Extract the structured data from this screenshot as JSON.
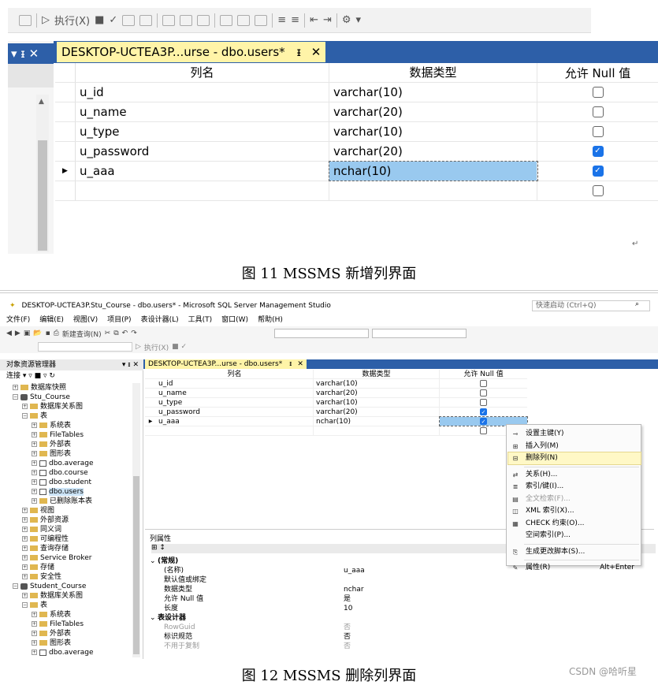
{
  "fig1": {
    "toolbar": {
      "execute_label": "执行(X)"
    },
    "tab": {
      "title": "DESKTOP-UCTEA3P...urse - dbo.users*",
      "pin": "ᵻ",
      "close": "✕"
    },
    "panel_controls": "▾ ᵻ ✕",
    "columns": {
      "name": "列名",
      "type": "数据类型",
      "null": "允许 Null 值"
    },
    "rows": [
      {
        "name": "u_id",
        "type": "varchar(10)",
        "null": false
      },
      {
        "name": "u_name",
        "type": "varchar(20)",
        "null": false
      },
      {
        "name": "u_type",
        "type": "varchar(10)",
        "null": false
      },
      {
        "name": "u_password",
        "type": "varchar(20)",
        "null": true
      },
      {
        "name": "u_aaa",
        "type": "nchar(10)",
        "null": true
      }
    ]
  },
  "caption1": "图 11 MSSMS 新增列界面",
  "fig2": {
    "title": "DESKTOP-UCTEA3P.Stu_Course - dbo.users* - Microsoft SQL Server Management Studio",
    "quick_launch": "快速启动 (Ctrl+Q)",
    "menu": [
      "文件(F)",
      "编辑(E)",
      "视图(V)",
      "项目(P)",
      "表设计器(L)",
      "工具(T)",
      "窗口(W)",
      "帮助(H)"
    ],
    "new_query": "新建查询(N)",
    "execute": "执行(X)",
    "object_explorer": {
      "title": "对象资源管理器",
      "connect": "连接 ▾",
      "tree": [
        {
          "label": "数据库快照",
          "indent": 2,
          "icon": "folder",
          "exp": "+"
        },
        {
          "label": "Stu_Course",
          "indent": 2,
          "icon": "db",
          "exp": "−"
        },
        {
          "label": "数据库关系图",
          "indent": 3,
          "icon": "folder",
          "exp": "+"
        },
        {
          "label": "表",
          "indent": 3,
          "icon": "folder",
          "exp": "−"
        },
        {
          "label": "系统表",
          "indent": 4,
          "icon": "folder",
          "exp": "+"
        },
        {
          "label": "FileTables",
          "indent": 4,
          "icon": "folder",
          "exp": "+"
        },
        {
          "label": "外部表",
          "indent": 4,
          "icon": "folder",
          "exp": "+"
        },
        {
          "label": "图形表",
          "indent": 4,
          "icon": "folder",
          "exp": "+"
        },
        {
          "label": "dbo.average",
          "indent": 4,
          "icon": "table",
          "exp": "+"
        },
        {
          "label": "dbo.course",
          "indent": 4,
          "icon": "table",
          "exp": "+"
        },
        {
          "label": "dbo.student",
          "indent": 4,
          "icon": "table",
          "exp": "+"
        },
        {
          "label": "dbo.users",
          "indent": 4,
          "icon": "table",
          "exp": "+",
          "selected": true
        },
        {
          "label": "已删除账本表",
          "indent": 4,
          "icon": "folder",
          "exp": "+"
        },
        {
          "label": "视图",
          "indent": 3,
          "icon": "folder",
          "exp": "+"
        },
        {
          "label": "外部资源",
          "indent": 3,
          "icon": "folder",
          "exp": "+"
        },
        {
          "label": "同义词",
          "indent": 3,
          "icon": "folder",
          "exp": "+"
        },
        {
          "label": "可编程性",
          "indent": 3,
          "icon": "folder",
          "exp": "+"
        },
        {
          "label": "查询存储",
          "indent": 3,
          "icon": "folder",
          "exp": "+"
        },
        {
          "label": "Service Broker",
          "indent": 3,
          "icon": "folder",
          "exp": "+"
        },
        {
          "label": "存储",
          "indent": 3,
          "icon": "folder",
          "exp": "+"
        },
        {
          "label": "安全性",
          "indent": 3,
          "icon": "folder",
          "exp": "+"
        },
        {
          "label": "Student_Course",
          "indent": 2,
          "icon": "db",
          "exp": "−"
        },
        {
          "label": "数据库关系图",
          "indent": 3,
          "icon": "folder",
          "exp": "+"
        },
        {
          "label": "表",
          "indent": 3,
          "icon": "folder",
          "exp": "−"
        },
        {
          "label": "系统表",
          "indent": 4,
          "icon": "folder",
          "exp": "+"
        },
        {
          "label": "FileTables",
          "indent": 4,
          "icon": "folder",
          "exp": "+"
        },
        {
          "label": "外部表",
          "indent": 4,
          "icon": "folder",
          "exp": "+"
        },
        {
          "label": "图形表",
          "indent": 4,
          "icon": "folder",
          "exp": "+"
        },
        {
          "label": "dbo.average",
          "indent": 4,
          "icon": "table",
          "exp": "+"
        }
      ]
    },
    "tab": "DESKTOP-UCTEA3P...urse - dbo.users*",
    "columns": {
      "name": "列名",
      "type": "数据类型",
      "null": "允许 Null 值"
    },
    "rows": [
      {
        "name": "u_id",
        "type": "varchar(10)",
        "null": false
      },
      {
        "name": "u_name",
        "type": "varchar(20)",
        "null": false
      },
      {
        "name": "u_type",
        "type": "varchar(10)",
        "null": false
      },
      {
        "name": "u_password",
        "type": "varchar(20)",
        "null": true
      },
      {
        "name": "u_aaa",
        "type": "nchar(10)",
        "null": true
      }
    ],
    "properties": {
      "title": "列属性",
      "items": [
        {
          "k": "(常规)",
          "v": "",
          "cat": true
        },
        {
          "k": "(名称)",
          "v": "u_aaa"
        },
        {
          "k": "默认值或绑定",
          "v": ""
        },
        {
          "k": "数据类型",
          "v": "nchar"
        },
        {
          "k": "允许 Null 值",
          "v": "是"
        },
        {
          "k": "长度",
          "v": "10"
        },
        {
          "k": "表设计器",
          "v": "",
          "cat": true
        },
        {
          "k": "RowGuid",
          "v": "否",
          "gray": true
        },
        {
          "k": "标识规范",
          "v": "否"
        },
        {
          "k": "不用于复制",
          "v": "否",
          "gray": true
        }
      ]
    },
    "context_menu": [
      {
        "label": "设置主键(Y)",
        "icon": "key-icon",
        "glyph": "⊸"
      },
      {
        "label": "插入列(M)",
        "icon": "insert-column-icon",
        "glyph": "⊞"
      },
      {
        "label": "删除列(N)",
        "icon": "delete-column-icon",
        "glyph": "⊟",
        "hover": true
      },
      {
        "sep": true
      },
      {
        "label": "关系(H)...",
        "icon": "relationship-icon",
        "glyph": "⇄"
      },
      {
        "label": "索引/键(I)...",
        "icon": "index-icon",
        "glyph": "≣"
      },
      {
        "label": "全文检索(F)...",
        "icon": "fulltext-icon",
        "glyph": "▤",
        "disabled": true
      },
      {
        "label": "XML 索引(X)...",
        "icon": "xml-index-icon",
        "glyph": "◫"
      },
      {
        "label": "CHECK 约束(O)...",
        "icon": "check-constraint-icon",
        "glyph": "▦"
      },
      {
        "label": "空间索引(P)...",
        "icon": "spatial-index-icon",
        "glyph": ""
      },
      {
        "sep": true
      },
      {
        "label": "生成更改脚本(S)...",
        "icon": "script-icon",
        "glyph": "⎘"
      },
      {
        "sep": true
      },
      {
        "label": "属性(R)",
        "icon": "wrench-icon",
        "glyph": "✎",
        "shortcut": "Alt+Enter"
      }
    ]
  },
  "caption2": "图 12 MSSMS 删除列界面",
  "watermark": "CSDN @哈听星"
}
